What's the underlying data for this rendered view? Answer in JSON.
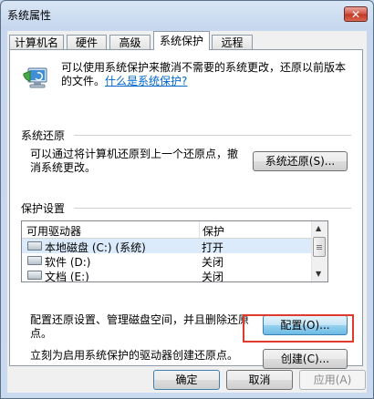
{
  "window": {
    "title": "系统属性",
    "close_glyph": "✕"
  },
  "tabs": [
    {
      "label": "计算机名"
    },
    {
      "label": "硬件"
    },
    {
      "label": "高级"
    },
    {
      "label": "系统保护"
    },
    {
      "label": "远程"
    }
  ],
  "active_tab": "系统保护",
  "intro": {
    "text": "可以使用系统保护来撤消不需要的系统更改，还原以前版本的文件。",
    "link": "什么是系统保护?"
  },
  "restore_group": {
    "title": "系统还原",
    "description": "可以通过将计算机还原到上一个还原点，撤消系统更改。",
    "button": "系统还原(S)..."
  },
  "protection_group": {
    "title": "保护设置",
    "columns": [
      "可用驱动器",
      "保护"
    ],
    "rows": [
      {
        "drive": "本地磁盘 (C:) (系统)",
        "protection": "打开",
        "icon": "system-drive-icon"
      },
      {
        "drive": "软件 (D:)",
        "protection": "关闭",
        "icon": "drive-icon"
      },
      {
        "drive": "文档 (E:)",
        "protection": "关闭",
        "icon": "drive-icon"
      }
    ],
    "configure_text": "配置还原设置、管理磁盘空间，并且删除还原点。",
    "configure_button": "配置(O)...",
    "create_text": "立刻为启用系统保护的驱动器创建还原点。",
    "create_button": "创建(C)..."
  },
  "footer": {
    "ok": "确定",
    "cancel": "取消",
    "apply": "应用(A)"
  },
  "highlight_color": "#e03a2f"
}
